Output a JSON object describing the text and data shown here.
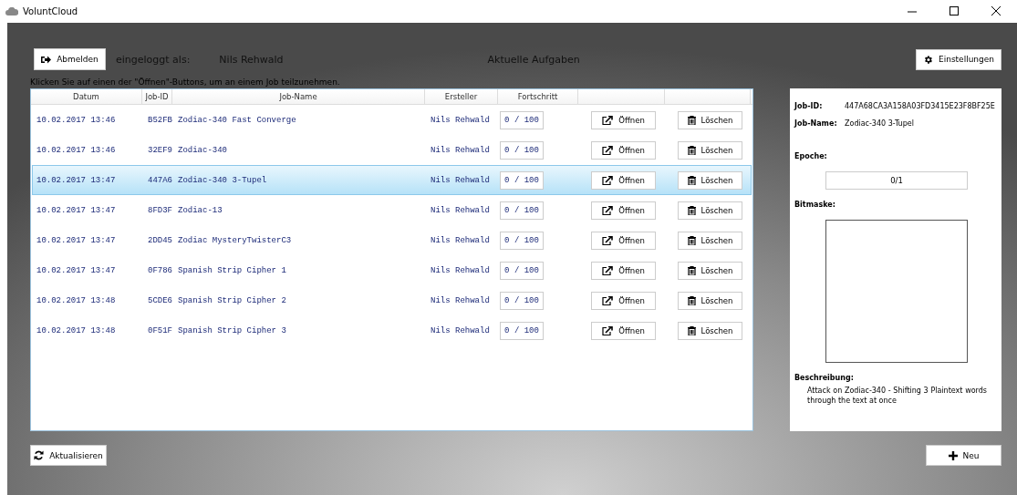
{
  "window": {
    "title": "VoluntCloud"
  },
  "header": {
    "logout_button": "Abmelden",
    "logged_in_label": "eingeloggt als:",
    "user_name": "Nils Rehwald",
    "heading": "Aktuelle Aufgaben",
    "settings_button": "Einstellungen"
  },
  "instruction": "Klicken Sie auf einen der \"Öffnen\"-Buttons, um an einem Job teilzunehmen.",
  "table": {
    "columns": [
      "Datum",
      "Job-ID",
      "Job-Name",
      "Ersteller",
      "Fortschritt"
    ],
    "rows": [
      {
        "date": "10.02.2017 13:46",
        "job_id": "B52FB",
        "job_name": "Zodiac-340 Fast Converge",
        "creator": "Nils Rehwald",
        "progress": "0 / 100",
        "open": "Öffnen",
        "delete": "Löschen",
        "selected": false
      },
      {
        "date": "10.02.2017 13:46",
        "job_id": "32EF9",
        "job_name": "Zodiac-340",
        "creator": "Nils Rehwald",
        "progress": "0 / 100",
        "open": "Öffnen",
        "delete": "Löschen",
        "selected": false
      },
      {
        "date": "10.02.2017 13:47",
        "job_id": "447A6",
        "job_name": "Zodiac-340 3-Tupel",
        "creator": "Nils Rehwald",
        "progress": "0 / 100",
        "open": "Öffnen",
        "delete": "Löschen",
        "selected": true
      },
      {
        "date": "10.02.2017 13:47",
        "job_id": "8FD3F",
        "job_name": "Zodiac-13",
        "creator": "Nils Rehwald",
        "progress": "0 / 100",
        "open": "Öffnen",
        "delete": "Löschen",
        "selected": false
      },
      {
        "date": "10.02.2017 13:47",
        "job_id": "2DD45",
        "job_name": "Zodiac MysteryTwisterC3",
        "creator": "Nils Rehwald",
        "progress": "0 / 100",
        "open": "Öffnen",
        "delete": "Löschen",
        "selected": false
      },
      {
        "date": "10.02.2017 13:47",
        "job_id": "0F786",
        "job_name": "Spanish Strip Cipher 1",
        "creator": "Nils Rehwald",
        "progress": "0 / 100",
        "open": "Öffnen",
        "delete": "Löschen",
        "selected": false
      },
      {
        "date": "10.02.2017 13:48",
        "job_id": "5CDE6",
        "job_name": "Spanish Strip Cipher 2",
        "creator": "Nils Rehwald",
        "progress": "0 / 100",
        "open": "Öffnen",
        "delete": "Löschen",
        "selected": false
      },
      {
        "date": "10.02.2017 13:48",
        "job_id": "0F51F",
        "job_name": "Spanish Strip Cipher 3",
        "creator": "Nils Rehwald",
        "progress": "0 / 100",
        "open": "Öffnen",
        "delete": "Löschen",
        "selected": false
      }
    ]
  },
  "details": {
    "job_id_label": "Job-ID:",
    "job_id": "447A68CA3A158A03FD3415E23F8BF25E",
    "job_name_label": "Job-Name:",
    "job_name": "Zodiac-340 3-Tupel",
    "epoch_label": "Epoche:",
    "epoch": "0/1",
    "bitmask_label": "Bitmaske:",
    "description_label": "Beschreibung:",
    "description": "Attack on Zodiac-340 - Shifting 3 Plaintext words through the text at once"
  },
  "footer": {
    "refresh_button": "Aktualisieren",
    "new_button": "Neu"
  }
}
